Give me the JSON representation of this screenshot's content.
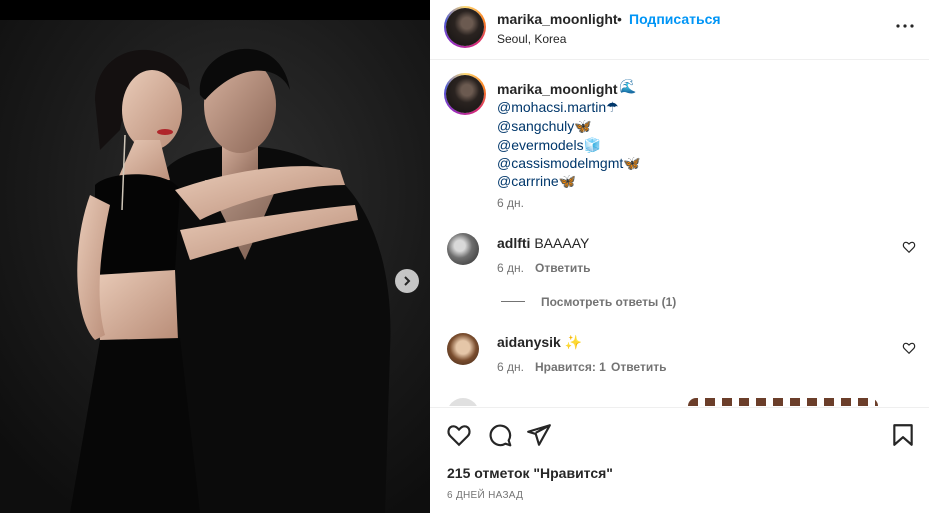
{
  "post": {
    "username": "marika_moonlight",
    "separator": "•",
    "follow_label": "Подписаться",
    "location": "Seoul, Korea"
  },
  "caption": {
    "username": "marika_moonlight",
    "emoji": "🌊",
    "mentions": [
      "@mohacsi.martin☂",
      "@sangchuly🦋",
      "@evermodels🧊",
      "@cassismodelmgmt🦋",
      "@carrrine🦋"
    ],
    "time": "6 дн."
  },
  "comments": [
    {
      "username": "adlfti",
      "text": "BAAAAY",
      "time": "6 дн.",
      "reply_label": "Ответить",
      "view_replies": "Посмотреть ответы (1)"
    },
    {
      "username": "aidanysik",
      "text": "✨",
      "time": "6 дн.",
      "likes_label": "Нравится: 1",
      "reply_label": "Ответить"
    }
  ],
  "footer": {
    "likes": "215 отметок \"Нравится\"",
    "date": "6 ДНЕЙ НАЗАД"
  },
  "icons": [
    "chevron-right-icon",
    "more-icon",
    "heart-icon",
    "comment-icon",
    "share-icon",
    "bookmark-icon"
  ],
  "colors": {
    "accent": "#0095f6",
    "mention": "#00376b",
    "muted": "#737373",
    "photo_bg": "#1c1c1c"
  }
}
